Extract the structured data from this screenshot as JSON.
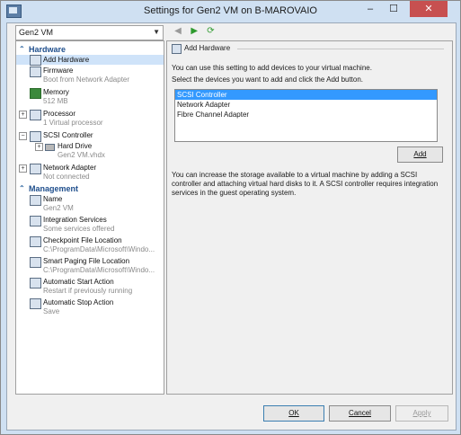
{
  "window": {
    "title": "Settings for Gen2 VM on B-MAROVAIO",
    "min": "–",
    "max": "☐",
    "close": "✕"
  },
  "vm_select": {
    "value": "Gen2 VM"
  },
  "nav": {
    "back": "◀",
    "forward": "▶",
    "refresh": "⟳"
  },
  "sections": {
    "hardware": "Hardware",
    "management": "Management"
  },
  "hardware": [
    {
      "label": "Add Hardware",
      "sub": ""
    },
    {
      "label": "Firmware",
      "sub": "Boot from Network Adapter"
    },
    {
      "label": "Memory",
      "sub": "512 MB"
    },
    {
      "label": "Processor",
      "sub": "1 Virtual processor"
    },
    {
      "label": "SCSI Controller",
      "sub": ""
    },
    {
      "label": "Hard Drive",
      "sub": "Gen2 VM.vhdx"
    },
    {
      "label": "Network Adapter",
      "sub": "Not connected"
    }
  ],
  "management": [
    {
      "label": "Name",
      "sub": "Gen2 VM"
    },
    {
      "label": "Integration Services",
      "sub": "Some services offered"
    },
    {
      "label": "Checkpoint File Location",
      "sub": "C:\\ProgramData\\Microsoft\\Windo..."
    },
    {
      "label": "Smart Paging File Location",
      "sub": "C:\\ProgramData\\Microsoft\\Windo..."
    },
    {
      "label": "Automatic Start Action",
      "sub": "Restart if previously running"
    },
    {
      "label": "Automatic Stop Action",
      "sub": "Save"
    }
  ],
  "panel": {
    "heading": "Add Hardware",
    "intro": "You can use this setting to add devices to your virtual machine.",
    "instruction": "Select the devices you want to add and click the Add button.",
    "devices": [
      "SCSI Controller",
      "Network Adapter",
      "Fibre Channel Adapter"
    ],
    "selected_device": "SCSI Controller",
    "add_button": "Add",
    "note": "You can increase the storage available to a virtual machine by adding a SCSI controller and attaching virtual hard disks to it. A SCSI controller requires integration services in the guest operating system."
  },
  "buttons": {
    "ok": "OK",
    "cancel": "Cancel",
    "apply": "Apply"
  }
}
